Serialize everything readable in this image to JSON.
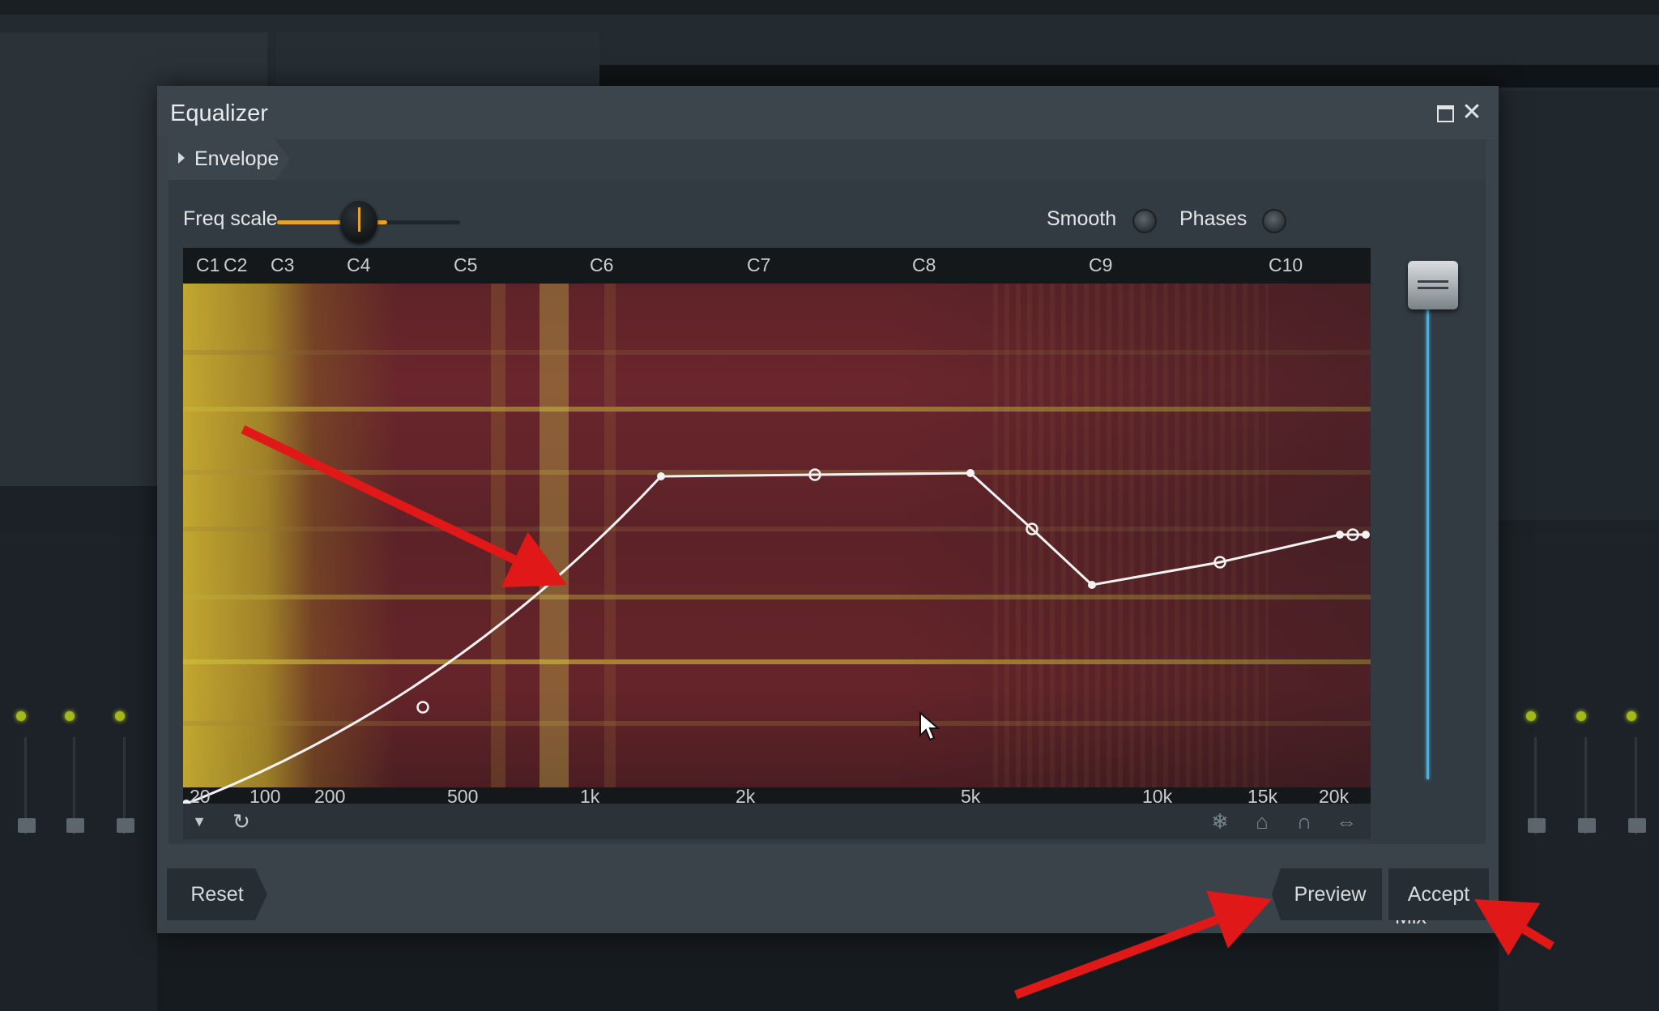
{
  "window": {
    "title": "Equalizer",
    "maximize_icon": "maximize-icon",
    "close_icon": "close-icon",
    "close_glyph": "✕"
  },
  "envelope": {
    "label": "Envelope"
  },
  "freq_scale": {
    "label": "Freq scale",
    "value": 0.6
  },
  "toggles": {
    "smooth": {
      "label": "Smooth",
      "on": false
    },
    "phases": {
      "label": "Phases",
      "on": false
    }
  },
  "graph": {
    "note_labels": [
      "C1",
      "C2",
      "C3",
      "C4",
      "C5",
      "C6",
      "C7",
      "C8",
      "C9",
      "C10"
    ],
    "freq_labels": [
      "20",
      "100",
      "200",
      "500",
      "1k",
      "2k",
      "5k",
      "10k",
      "15k",
      "20k"
    ],
    "curve_color": "#f2f2f2",
    "spectrogram_colors": {
      "low": "#5e2328",
      "high": "#d2be32"
    }
  },
  "tools": {
    "dropdown_icon": "chevron-down-icon",
    "reset_view_icon": "refresh-icon",
    "freeze_icon": "snowflake-icon",
    "tag_icon": "tag-icon",
    "listen_icon": "headphones-icon",
    "stretch_icon": "stretch-icon"
  },
  "mix": {
    "label": "Mix",
    "value": 1.0,
    "line_color": "#3fb6e6"
  },
  "buttons": {
    "reset": "Reset",
    "preview": "Preview",
    "accept": "Accept"
  },
  "annotation_color": "#e01818"
}
